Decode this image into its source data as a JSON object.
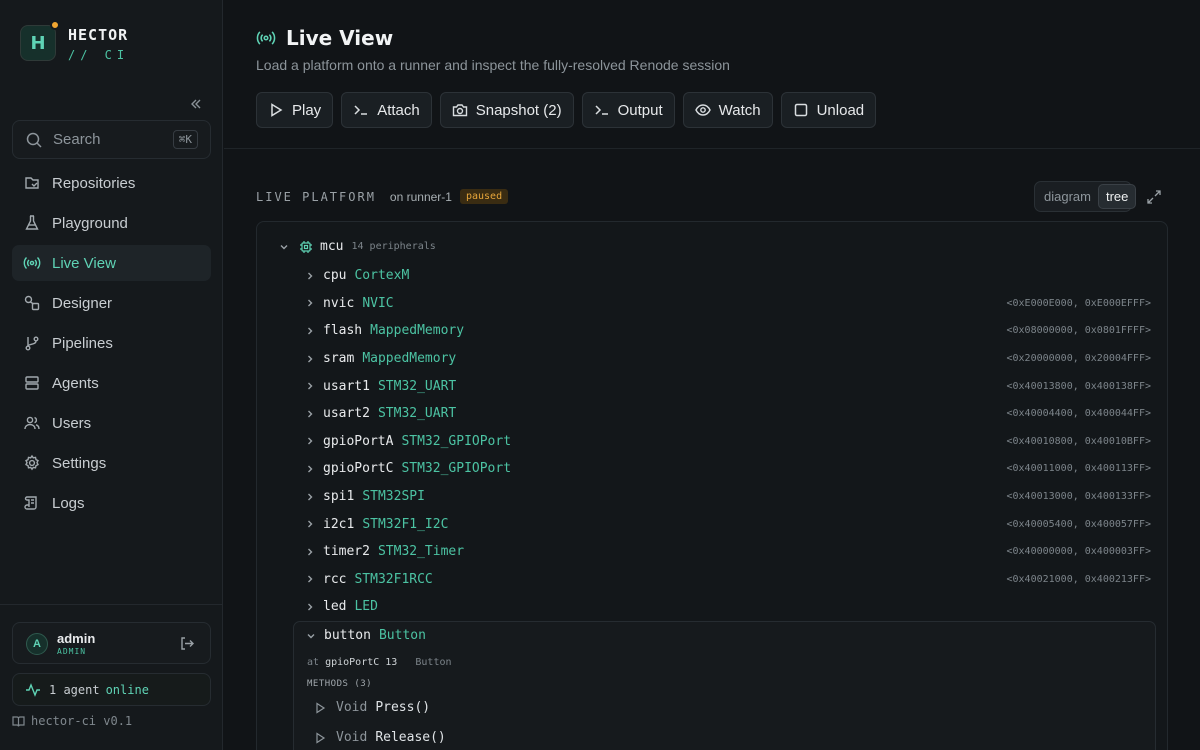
{
  "brand": {
    "initial": "H",
    "name": "HECTOR",
    "sub": "// CI"
  },
  "search": {
    "placeholder": "Search",
    "shortcut": "⌘K"
  },
  "nav": [
    {
      "label": "Repositories",
      "icon": "repo-icon"
    },
    {
      "label": "Playground",
      "icon": "flask-icon"
    },
    {
      "label": "Live View",
      "icon": "broadcast-icon",
      "active": true
    },
    {
      "label": "Designer",
      "icon": "shapes-icon"
    },
    {
      "label": "Pipelines",
      "icon": "git-branch-icon"
    },
    {
      "label": "Agents",
      "icon": "server-icon"
    },
    {
      "label": "Users",
      "icon": "users-icon"
    },
    {
      "label": "Settings",
      "icon": "gear-icon"
    },
    {
      "label": "Logs",
      "icon": "scroll-icon"
    }
  ],
  "user": {
    "initial": "A",
    "name": "admin",
    "role": "ADMIN"
  },
  "agents": {
    "count": "1 agent",
    "status": "online"
  },
  "version": "hector-ci v0.1",
  "page": {
    "title": "Live View",
    "subtitle": "Load a platform onto a runner and inspect the fully-resolved Renode session"
  },
  "toolbar": {
    "play": "Play",
    "attach": "Attach",
    "snapshot": "Snapshot (2)",
    "output": "Output",
    "watch": "Watch",
    "unload": "Unload"
  },
  "platform": {
    "section_title": "LIVE PLATFORM",
    "runner": "on runner-1",
    "state": "paused",
    "view_diagram": "diagram",
    "view_tree": "tree",
    "view_selected": "tree",
    "root_name": "mcu",
    "root_count": "14 peripherals",
    "peripherals": [
      {
        "name": "cpu",
        "type": "CortexM",
        "range": ""
      },
      {
        "name": "nvic",
        "type": "NVIC",
        "range": "<0xE000E000, 0xE000EFFF>"
      },
      {
        "name": "flash",
        "type": "MappedMemory",
        "range": "<0x08000000, 0x0801FFFF>"
      },
      {
        "name": "sram",
        "type": "MappedMemory",
        "range": "<0x20000000, 0x20004FFF>"
      },
      {
        "name": "usart1",
        "type": "STM32_UART",
        "range": "<0x40013800, 0x400138FF>"
      },
      {
        "name": "usart2",
        "type": "STM32_UART",
        "range": "<0x40004400, 0x400044FF>"
      },
      {
        "name": "gpioPortA",
        "type": "STM32_GPIOPort",
        "range": "<0x40010800, 0x40010BFF>"
      },
      {
        "name": "gpioPortC",
        "type": "STM32_GPIOPort",
        "range": "<0x40011000, 0x400113FF>"
      },
      {
        "name": "spi1",
        "type": "STM32SPI",
        "range": "<0x40013000, 0x400133FF>"
      },
      {
        "name": "i2c1",
        "type": "STM32F1_I2C",
        "range": "<0x40005400, 0x400057FF>"
      },
      {
        "name": "timer2",
        "type": "STM32_Timer",
        "range": "<0x40000000, 0x400003FF>"
      },
      {
        "name": "rcc",
        "type": "STM32F1RCC",
        "range": "<0x40021000, 0x400213FF>"
      },
      {
        "name": "led",
        "type": "LED",
        "range": ""
      }
    ],
    "expanded": {
      "name": "button",
      "type": "Button",
      "at_prefix": "at",
      "at_target": "gpioPortC 13",
      "at_type": "Button",
      "methods_label": "METHODS (3)",
      "methods": [
        {
          "ret": "Void",
          "name": "Press()"
        },
        {
          "ret": "Void",
          "name": "Release()"
        }
      ]
    }
  },
  "colors": {
    "accent": "#5fd3b5",
    "paused": "#e6a53a",
    "background": "#111417"
  }
}
